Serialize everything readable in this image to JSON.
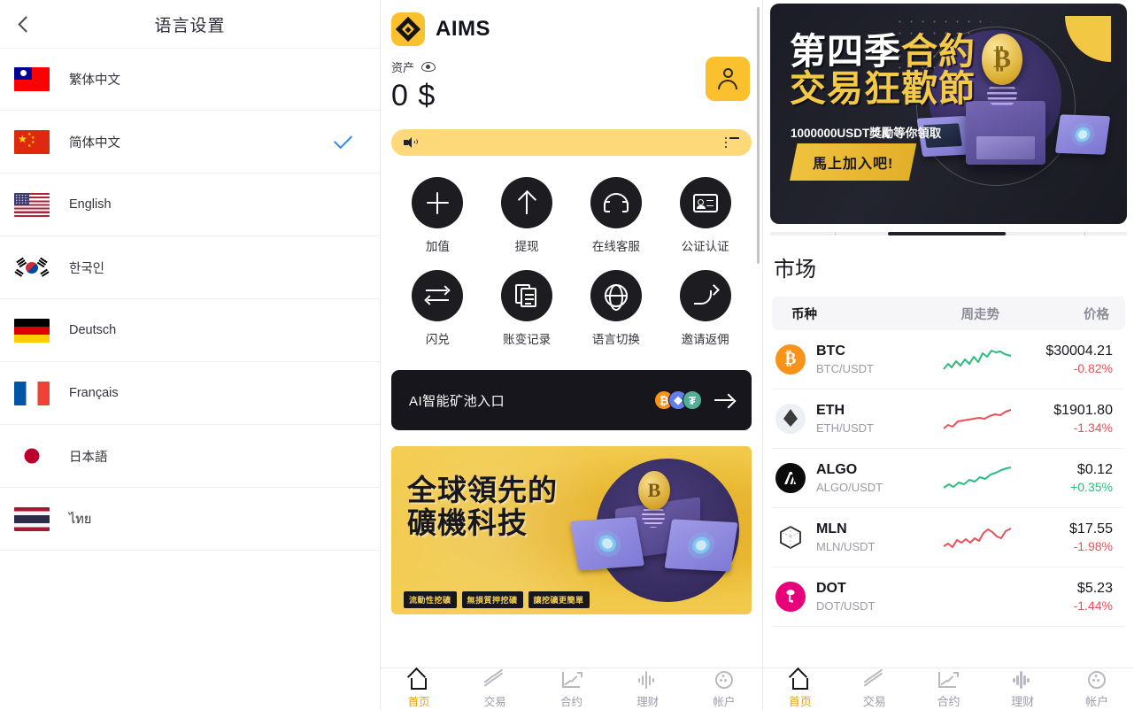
{
  "language_panel": {
    "title": "语言设置",
    "back_icon": "chevron-left-icon",
    "items": [
      {
        "label": "繁体中文",
        "flag": "tw",
        "selected": false
      },
      {
        "label": "简体中文",
        "flag": "cn",
        "selected": true
      },
      {
        "label": "English",
        "flag": "us",
        "selected": false
      },
      {
        "label": "한국인",
        "flag": "kr",
        "selected": false
      },
      {
        "label": "Deutsch",
        "flag": "de",
        "selected": false
      },
      {
        "label": "Français",
        "flag": "fr",
        "selected": false
      },
      {
        "label": "日本語",
        "flag": "jp",
        "selected": false
      },
      {
        "label": "ไทย",
        "flag": "th",
        "selected": false
      }
    ]
  },
  "app": {
    "brand_name": "AIMS",
    "assets_label": "资产",
    "assets_amount": "0 $",
    "eye_icon": "eye-icon",
    "avatar_icon": "user-icon",
    "notice": {
      "speaker_icon": "speaker-icon",
      "list_icon": "list-icon",
      "text": ""
    },
    "shortcuts": [
      {
        "label": "加值",
        "icon": "plus-icon"
      },
      {
        "label": "提现",
        "icon": "arrow-up-icon"
      },
      {
        "label": "在线客服",
        "icon": "headset-icon"
      },
      {
        "label": "公证认证",
        "icon": "id-card-icon"
      },
      {
        "label": "闪兑",
        "icon": "swap-icon"
      },
      {
        "label": "账变记录",
        "icon": "documents-icon"
      },
      {
        "label": "语言切换",
        "icon": "globe-icon"
      },
      {
        "label": "邀请返佣",
        "icon": "share-arrow-icon"
      }
    ],
    "ai_banner": {
      "text": "AI智能矿池入口",
      "coins": [
        "₿",
        "◆",
        "₮"
      ],
      "arrow_icon": "arrow-right-icon"
    },
    "promo_banner": {
      "line1": "全球領先的",
      "line2": "礦機科技",
      "tags": [
        "流動性挖礦",
        "無損質押挖礦",
        "讓挖礦更簡單"
      ]
    }
  },
  "bottom_nav": {
    "items": [
      {
        "label": "首页",
        "icon": "home-icon",
        "active": true
      },
      {
        "label": "交易",
        "icon": "trade-icon",
        "active": false
      },
      {
        "label": "合约",
        "icon": "contract-chart-icon",
        "active": false
      },
      {
        "label": "理财",
        "icon": "finance-wave-icon",
        "active": false
      },
      {
        "label": "帐户",
        "icon": "account-icon",
        "active": false
      }
    ]
  },
  "market_panel": {
    "hero_banner": {
      "line1_white": "第四季",
      "line1_yellow": "合約",
      "line2": "交易狂歡節",
      "subtitle": "1000000USDT獎勵等你領取",
      "cta": "馬上加入吧!",
      "coin_glyph": "₿"
    },
    "carousel": {
      "active_index": 1,
      "count": 3
    },
    "title": "市场",
    "columns": {
      "coin": "币种",
      "trend": "周走势",
      "price": "价格"
    },
    "rows": [
      {
        "symbol": "BTC",
        "pair": "BTC/USDT",
        "price": "$30004.21",
        "change": "-0.82%",
        "direction": "down",
        "trend": "up",
        "badge": "btc",
        "glyph": "₿"
      },
      {
        "symbol": "ETH",
        "pair": "ETH/USDT",
        "price": "$1901.80",
        "change": "-1.34%",
        "direction": "down",
        "trend": "down",
        "badge": "eth",
        "glyph": ""
      },
      {
        "symbol": "ALGO",
        "pair": "ALGO/USDT",
        "price": "$0.12",
        "change": "+0.35%",
        "direction": "up",
        "trend": "up",
        "badge": "algo",
        "glyph": ""
      },
      {
        "symbol": "MLN",
        "pair": "MLN/USDT",
        "price": "$17.55",
        "change": "-1.98%",
        "direction": "down",
        "trend": "down",
        "badge": "mln",
        "glyph": ""
      },
      {
        "symbol": "DOT",
        "pair": "DOT/USDT",
        "price": "$5.23",
        "change": "-1.44%",
        "direction": "down",
        "trend": "none",
        "badge": "dot",
        "glyph": ""
      }
    ]
  },
  "colors": {
    "brand_yellow": "#fbc02d",
    "notice_yellow": "#fdd97a",
    "dark": "#1c1c21",
    "up_green": "#2bbd7e",
    "down_red": "#e8515a",
    "check_blue": "#2d8cf0",
    "active_nav": "#e8a317"
  }
}
